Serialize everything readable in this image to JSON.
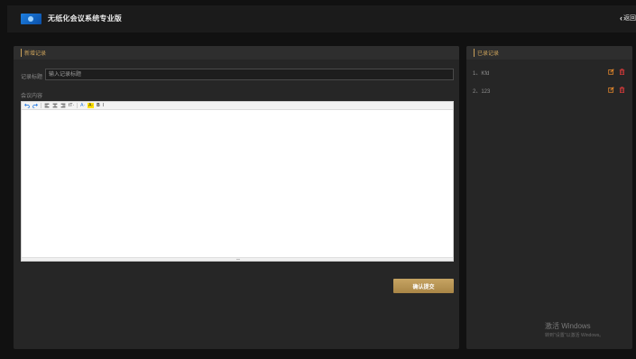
{
  "header": {
    "title": "无纸化会议系统专业版",
    "back_label": "返回"
  },
  "form": {
    "panel_title": "新增记录",
    "title_label": "记录标题",
    "title_placeholder": "输入记录标题",
    "content_label": "会议内容",
    "submit_label": "确认提交"
  },
  "editor_toolbar": [
    "undo-icon",
    "redo-icon",
    "align-left-icon",
    "align-center-icon",
    "align-right-icon",
    "font-size-icon",
    "font-color-icon",
    "highlight-icon",
    "bold-icon",
    "italic-icon"
  ],
  "editor_toolbar_text": {
    "font_size": "tT·",
    "font_color": "A·",
    "highlight": "A·",
    "bold": "B",
    "italic": "I"
  },
  "records": {
    "panel_title": "已录记录",
    "items": [
      {
        "label": "1、Kfd"
      },
      {
        "label": "2、123"
      }
    ]
  },
  "watermark": {
    "line1": "激活 Windows",
    "line2": "转到\"设置\"以激活 Windows。"
  },
  "colors": {
    "accent": "#c9a05a",
    "edit_icon": "#d9822b",
    "delete_icon": "#d63a3a",
    "button": "#b8955a"
  }
}
